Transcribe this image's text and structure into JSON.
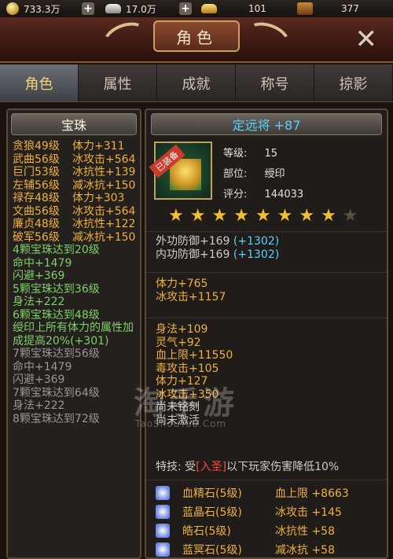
{
  "topbar": {
    "coins": "733.3万",
    "silver": "17.0万",
    "gold": "101",
    "bag": "377"
  },
  "header": {
    "title": "角色"
  },
  "tabs": [
    {
      "label": "角色"
    },
    {
      "label": "属性"
    },
    {
      "label": "成就"
    },
    {
      "label": "称号"
    },
    {
      "label": "掠影"
    }
  ],
  "left": {
    "title": "宝珠",
    "beads": [
      {
        "name": "贪狼49级",
        "effect": "体力+311"
      },
      {
        "name": "武曲56级",
        "effect": "冰攻击+564"
      },
      {
        "name": "巨门53级",
        "effect": "冰抗性+139"
      },
      {
        "name": "左辅56级",
        "effect": "减冰抗+150"
      },
      {
        "name": "禄存48级",
        "effect": "体力+303"
      },
      {
        "name": "文曲56级",
        "effect": "冰攻击+564"
      },
      {
        "name": "廉贞48级",
        "effect": "冰抗性+122"
      },
      {
        "name": "破军56级",
        "effect": "减冰抗+150"
      }
    ],
    "sets": [
      {
        "text": "4颗宝珠达到20级",
        "tone": "g"
      },
      {
        "text": "命中+1479",
        "tone": "g"
      },
      {
        "text": "闪避+369",
        "tone": "g"
      },
      {
        "text": "5颗宝珠达到36级",
        "tone": "g"
      },
      {
        "text": "身法+222",
        "tone": "g"
      },
      {
        "text": "6颗宝珠达到48级",
        "tone": "g"
      },
      {
        "text": "绶印上所有体力的属性加成提高20%(+301)",
        "tone": "g"
      },
      {
        "text": "7颗宝珠达到56级",
        "tone": "gr"
      },
      {
        "text": "命中+1479",
        "tone": "gr"
      },
      {
        "text": "闪避+369",
        "tone": "gr"
      },
      {
        "text": "7颗宝珠达到64级",
        "tone": "gr"
      },
      {
        "text": "身法+222",
        "tone": "gr"
      },
      {
        "text": "8颗宝珠达到72级",
        "tone": "gr"
      }
    ]
  },
  "right": {
    "name": "定远将 +87",
    "equipped_tag": "已装备",
    "level_label": "等级:",
    "level": "15",
    "slot_label": "部位:",
    "slot": "绶印",
    "score_label": "评分:",
    "score": "144033",
    "stars_filled": 8,
    "stars_total": 9,
    "defense": [
      {
        "base": "外功防御+169",
        "bonus": "(+1302)"
      },
      {
        "base": "内功防御+169",
        "bonus": "(+1302)"
      }
    ],
    "main_stats": [
      "体力+765",
      "冰攻击+1157"
    ],
    "extra_stats": [
      "身法+109",
      "灵气+92",
      "血上限+11550",
      "毒攻击+105",
      "体力+127",
      "冰攻击+350"
    ],
    "engrave": [
      "尚未铭刻",
      "尚未激活"
    ],
    "skill_label": "特技:",
    "skill_pre": "受",
    "skill_tag": "[入圣]",
    "skill_post": "以下玩家伤害降低10%",
    "stones": [
      {
        "name": "血精石(5级)",
        "effect": "血上限 +8663"
      },
      {
        "name": "蓝晶石(5级)",
        "effect": "冰攻击 +145"
      },
      {
        "name": "皓石(5级)",
        "effect": "冰抗性 +58"
      },
      {
        "name": "蓝冥石(5级)",
        "effect": "减冰抗 +58"
      }
    ]
  },
  "watermark": {
    "text": "淘手游",
    "url": "TaoShouYou.Com"
  },
  "colors": {
    "accent_gold": "#f0b040",
    "active_green": "#7fd06a",
    "bonus_blue": "#5ad0ff",
    "skill_red": "#ff4a3a"
  }
}
